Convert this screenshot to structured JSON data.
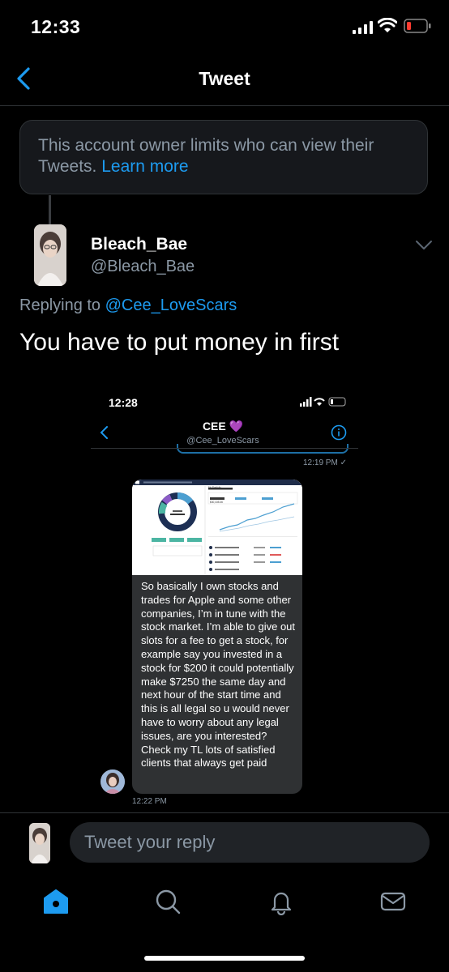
{
  "status_bar": {
    "time": "12:33"
  },
  "nav": {
    "title": "Tweet"
  },
  "notice": {
    "text": "This account owner limits who can view their Tweets.",
    "link": "Learn more"
  },
  "tweet": {
    "display_name": "Bleach_Bae",
    "handle": "@Bleach_Bae",
    "replying_prefix": "Replying to",
    "replying_to": "@Cee_LoveScars",
    "text": "You have to put money in first"
  },
  "embedded": {
    "time": "12:28",
    "contact_name": "CEE 💜",
    "contact_handle": "@Cee_LoveScars",
    "timestamp_1": "12:19 PM ✓",
    "message": "So basically I own stocks and trades for Apple and some other companies, I’m in tune with the stock market. I’m able to give out slots for a fee to get a stock, for example say you invested in a stock for $200 it could potentially make $7250 the same day and next hour of the start time and this is all legal so u would never have to worry about any legal issues, are you interested? Check my TL lots of satisfied clients that always get paid",
    "timestamp_2": "12:22 PM",
    "portfolio_title": "My Portfolio",
    "portfolio_value": "$30,435.46"
  },
  "reply": {
    "placeholder": "Tweet your reply"
  },
  "tabs": [
    "home-icon",
    "search-icon",
    "notifications-icon",
    "messages-icon"
  ],
  "colors": {
    "accent": "#1d9bf0",
    "background": "#000000",
    "muted": "#8b98a5"
  }
}
